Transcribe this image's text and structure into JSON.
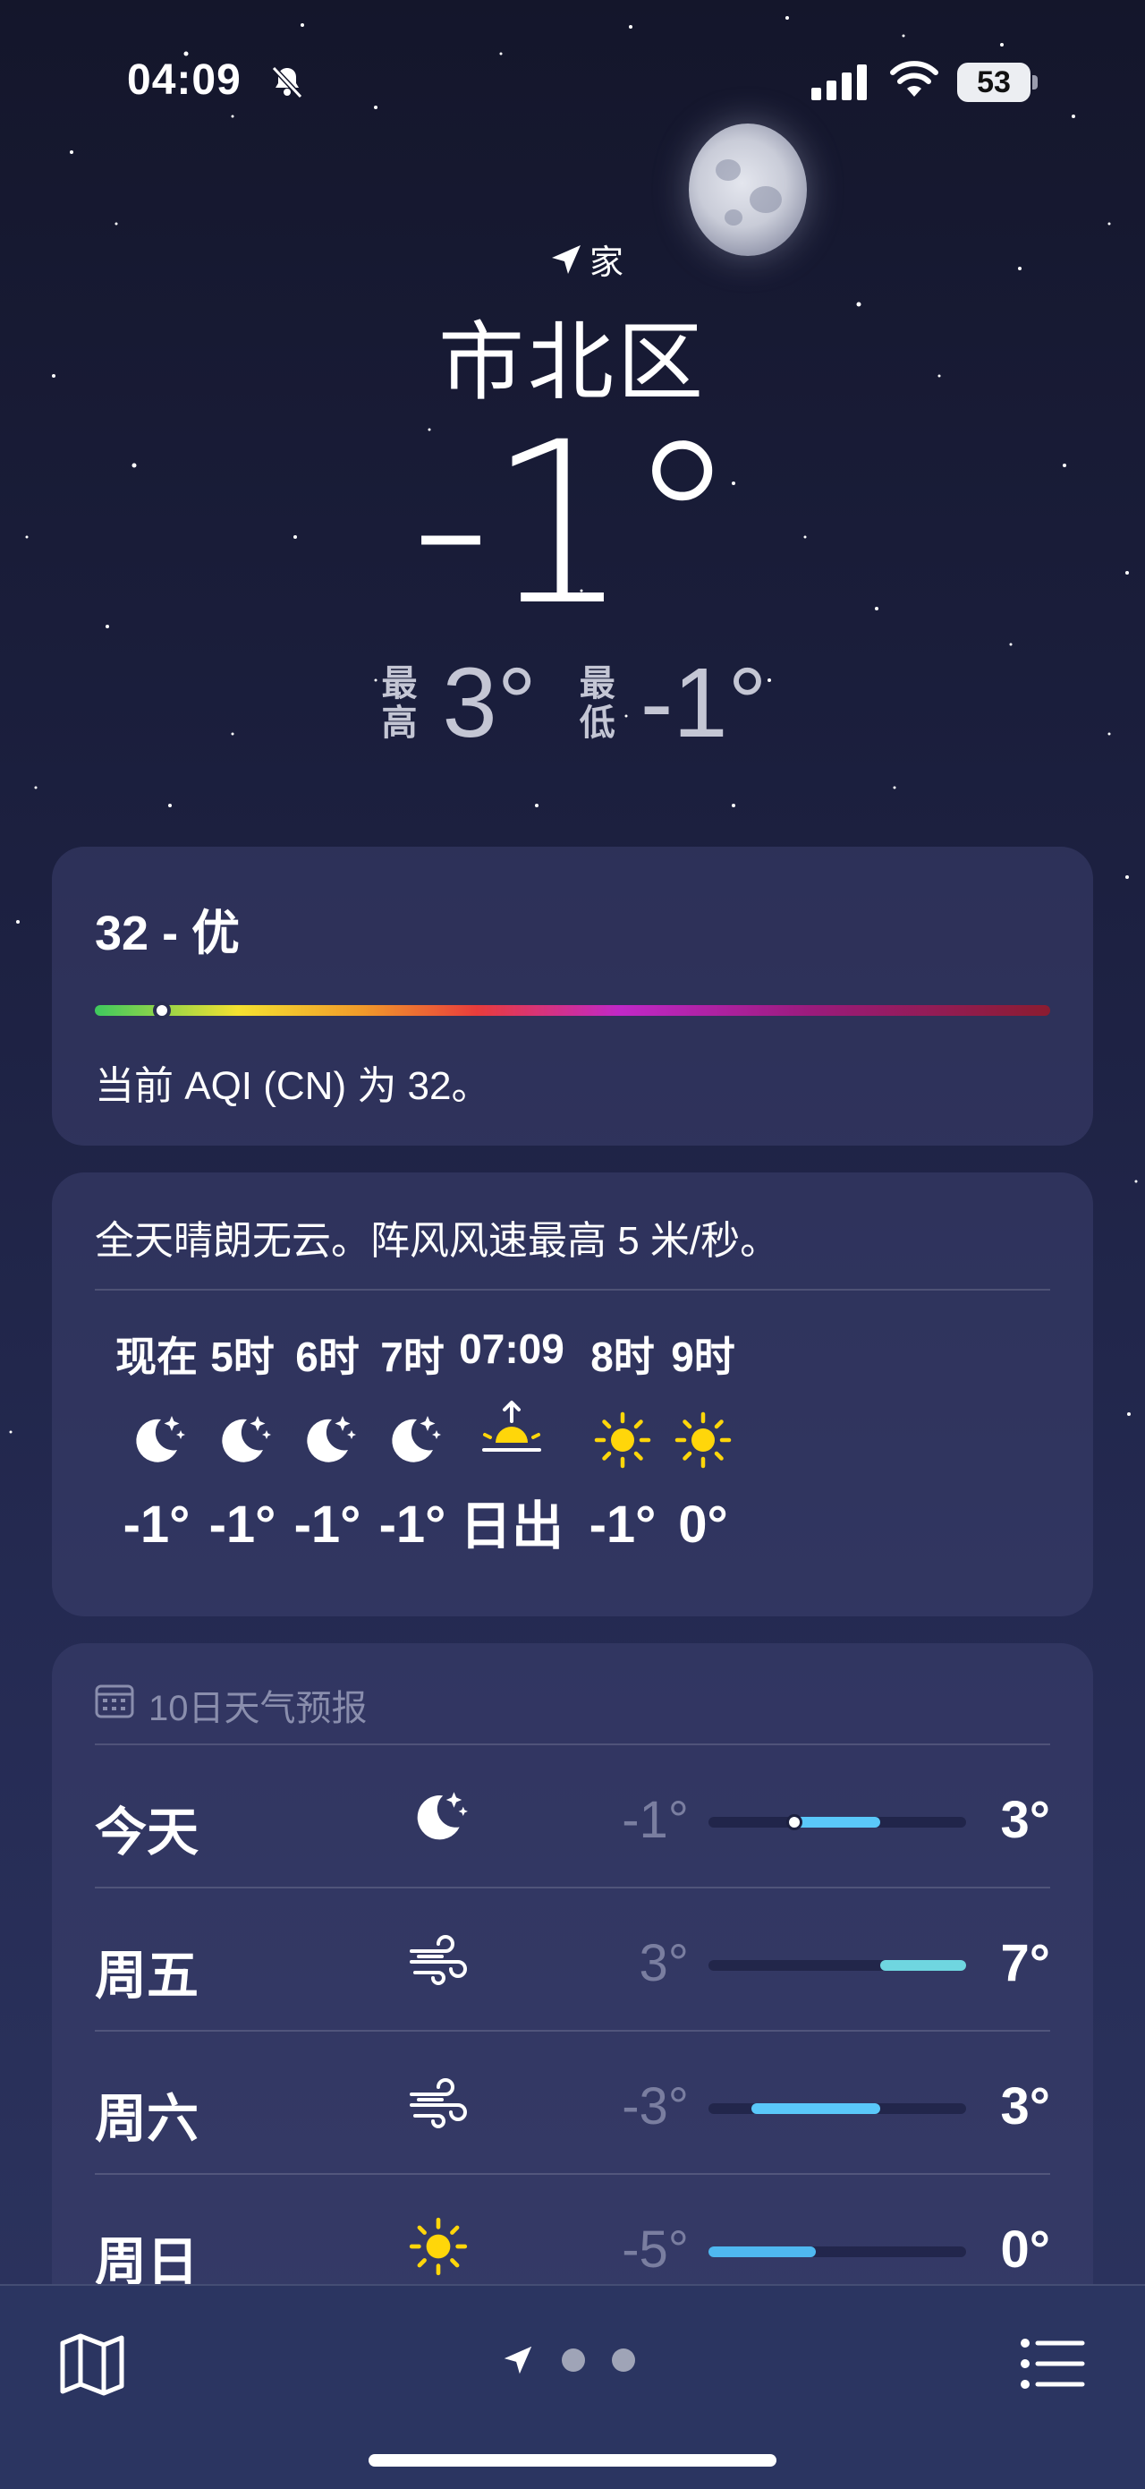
{
  "status": {
    "time": "04:09",
    "battery": "53",
    "icons": [
      "bell-slash-icon",
      "signal-icon",
      "wifi-icon",
      "battery-icon"
    ]
  },
  "location": {
    "label": "家",
    "city": "市北区",
    "current_temp": "-1°",
    "high_label": "最高",
    "high": "3°",
    "low_label": "最低",
    "low": "-1°"
  },
  "aqi": {
    "value_text": "32 - 优",
    "description": "当前 AQI (CN) 为 32。",
    "level": 0.07
  },
  "hourly": {
    "summary": "全天晴朗无云。阵风风速最高 5 米/秒。",
    "items": [
      {
        "label": "现在",
        "icon": "moon-stars-icon",
        "temp": "-1°"
      },
      {
        "label": "5时",
        "icon": "moon-stars-icon",
        "temp": "-1°"
      },
      {
        "label": "6时",
        "icon": "moon-stars-icon",
        "temp": "-1°"
      },
      {
        "label": "7时",
        "icon": "moon-stars-icon",
        "temp": "-1°"
      },
      {
        "label": "07:09",
        "icon": "sunrise-icon",
        "temp": "日出"
      },
      {
        "label": "8时",
        "icon": "sun-icon",
        "temp": "-1°"
      },
      {
        "label": "9时",
        "icon": "sun-icon",
        "temp": "0°"
      }
    ]
  },
  "daily": {
    "title": "10日天气预报",
    "range": [
      -5,
      7
    ],
    "days": [
      {
        "name": "今天",
        "icon": "moon-stars-icon",
        "low": "-1°",
        "high": "3°",
        "low_val": -1,
        "high_val": 3,
        "current": -1,
        "color": "#5ac8fa"
      },
      {
        "name": "周五",
        "icon": "wind-icon",
        "low": "3°",
        "high": "7°",
        "low_val": 3,
        "high_val": 7,
        "color": "#6fd6e0"
      },
      {
        "name": "周六",
        "icon": "wind-icon",
        "low": "-3°",
        "high": "3°",
        "low_val": -3,
        "high_val": 3,
        "color": "#5ac8fa"
      },
      {
        "name": "周日",
        "icon": "sun-icon",
        "low": "-5°",
        "high": "0°",
        "low_val": -5,
        "high_val": 0,
        "color": "#4fb8f0"
      }
    ]
  },
  "toolbar": {
    "icons": [
      "map-icon",
      "location-arrow-icon",
      "list-icon"
    ]
  },
  "colors": {
    "background_top": "#14162b",
    "card": "#3c406e",
    "sun": "#ffd60a"
  }
}
